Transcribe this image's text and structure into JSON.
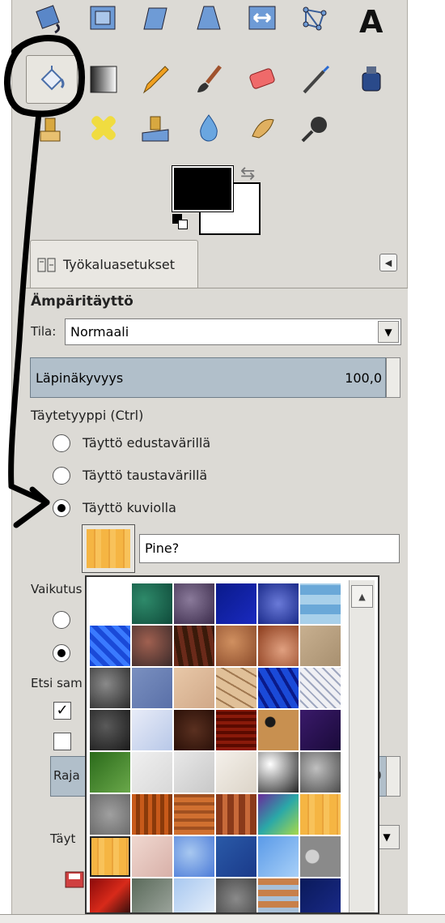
{
  "toolbox": {
    "tools": [
      {
        "name": "rotate-tool-icon"
      },
      {
        "name": "scale-tool-icon"
      },
      {
        "name": "shear-tool-icon"
      },
      {
        "name": "perspective-tool-icon"
      },
      {
        "name": "flip-tool-icon"
      },
      {
        "name": "cage-transform-tool-icon"
      },
      {
        "name": "text-tool-icon"
      },
      {
        "name": "bucket-fill-tool-icon",
        "active": true
      },
      {
        "name": "blend-tool-icon"
      },
      {
        "name": "pencil-tool-icon"
      },
      {
        "name": "paintbrush-tool-icon"
      },
      {
        "name": "eraser-tool-icon"
      },
      {
        "name": "airbrush-tool-icon"
      },
      {
        "name": "ink-tool-icon"
      },
      {
        "name": "clone-tool-icon"
      },
      {
        "name": "heal-tool-icon"
      },
      {
        "name": "perspective-clone-tool-icon"
      },
      {
        "name": "blur-sharpen-tool-icon"
      },
      {
        "name": "smudge-tool-icon"
      },
      {
        "name": "dodge-burn-tool-icon"
      }
    ],
    "foreground_color": "#000000",
    "background_color": "#ffffff"
  },
  "tab": {
    "label": "Työkaluasetukset"
  },
  "options": {
    "tool_name": "Ämpäritäyttö",
    "mode_label": "Tila:",
    "mode_value": "Normaali",
    "opacity_label": "Läpinäkyvyys",
    "opacity_value": "100,0",
    "fill_type_label": "Täytetyyppi (Ctrl)",
    "fill_types": [
      {
        "label": "Täyttö edustavärillä",
        "selected": false
      },
      {
        "label": "Täyttö taustavärillä",
        "selected": false
      },
      {
        "label": "Täyttö kuviolla",
        "selected": true
      }
    ],
    "pattern_name": "Pine?",
    "affected_label_partial": "Vaikutus",
    "etsi_label_partial": "Etsi sam",
    "threshold_label_partial": "Raja",
    "threshold_value_partial": "0",
    "fill_by_label_partial": "Täyt"
  },
  "pattern_popup": {
    "patterns": [
      "white",
      "green-marble",
      "purple-stone",
      "blue-dark",
      "blue-speckle",
      "blue-squares",
      "blue-web",
      "red-stones",
      "brown-bark",
      "tan-leather",
      "swirl-brown",
      "sand",
      "grey-rock",
      "blue-grey",
      "beige",
      "cracked-clay",
      "blue-crack",
      "white-crack",
      "dark-rock",
      "ice",
      "coffee-beans",
      "red-stripes",
      "leopard",
      "purple-dark",
      "green-leaves",
      "white-marble",
      "light-marble",
      "white-grain",
      "dark-grad",
      "grey-rough",
      "grey-granite",
      "rust",
      "orange-wood",
      "bookshelf",
      "rainbow",
      "pine-wood",
      "pine",
      "pink-marble",
      "blue-clouds",
      "blue-box",
      "blue-wave",
      "grey-circles",
      "red-fire",
      "stone-wall",
      "sky-clouds",
      "grey-stone",
      "bricks-colour",
      "dark-blue"
    ],
    "selected_index": 6
  }
}
